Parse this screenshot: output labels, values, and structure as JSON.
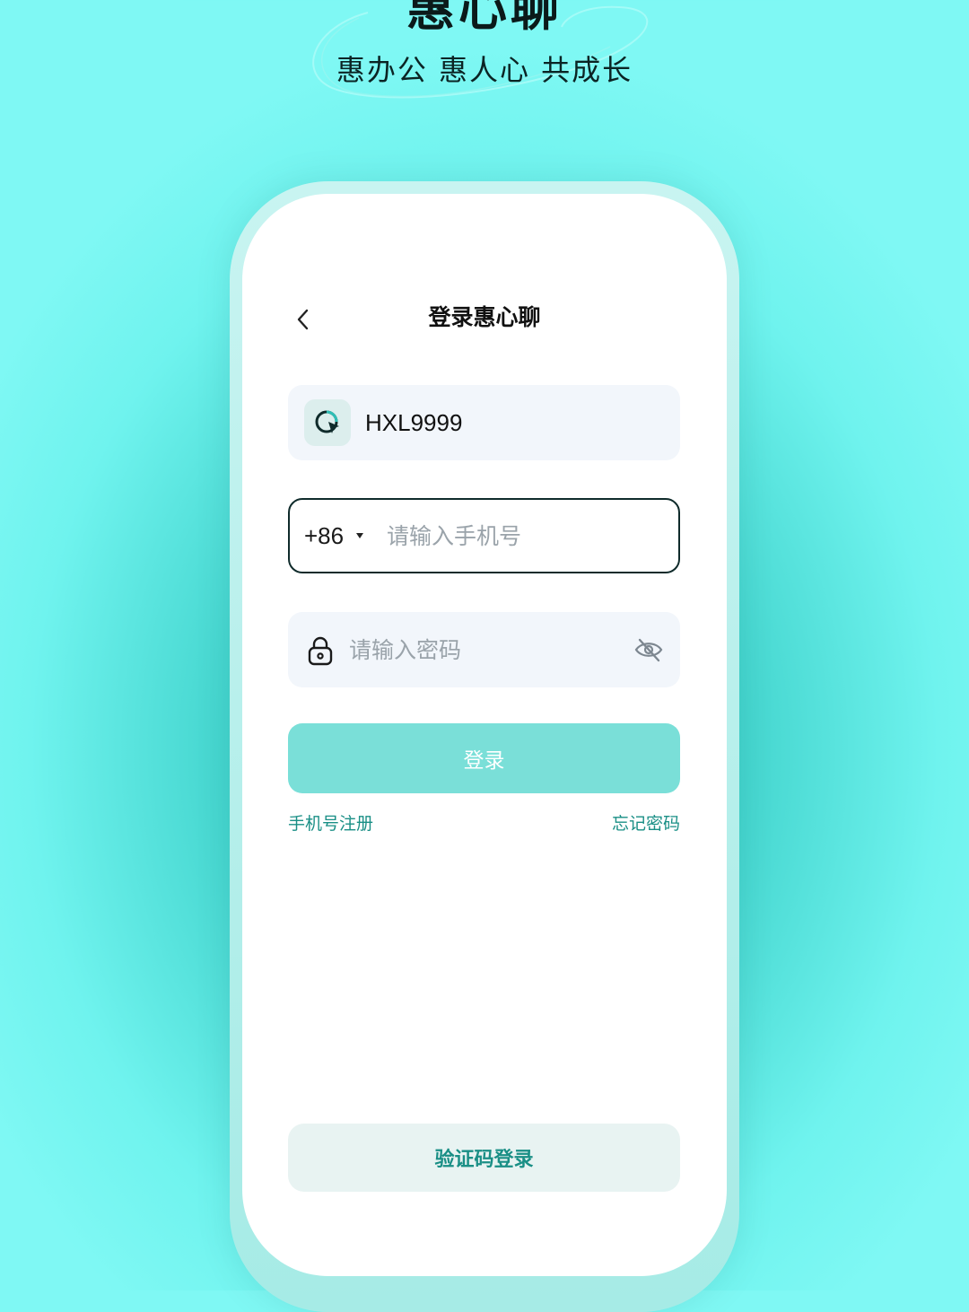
{
  "hero": {
    "title": "惠心聊",
    "slogan": "惠办公 惠人心 共成长"
  },
  "screen": {
    "title": "登录惠心聊",
    "back_icon": "chevron-left-icon"
  },
  "account": {
    "icon": "app-logo-icon",
    "value": "HXL9999"
  },
  "phone": {
    "country_code": "+86",
    "placeholder": "请输入手机号",
    "value": ""
  },
  "password": {
    "lock_icon": "lock-icon",
    "placeholder": "请输入密码",
    "visibility_icon": "eye-off-icon"
  },
  "actions": {
    "login_label": "登录",
    "register_label": "手机号注册",
    "forgot_label": "忘记密码",
    "code_login_label": "验证码登录"
  },
  "colors": {
    "accent": "#1a8f86",
    "login_button": "#7adfd8",
    "background": "#45d6cf"
  }
}
